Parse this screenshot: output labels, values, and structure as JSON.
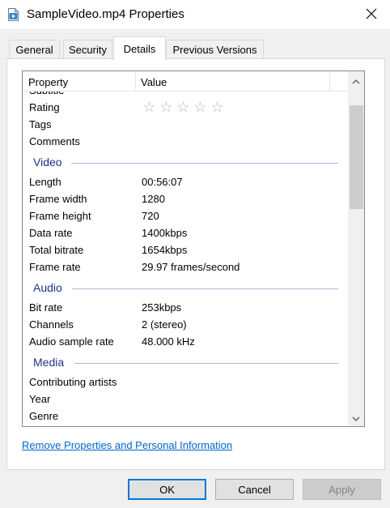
{
  "window": {
    "title": "SampleVideo.mp4 Properties",
    "icon": "video-file-icon",
    "close_icon": "close-icon"
  },
  "tabs": [
    {
      "label": "General",
      "active": false
    },
    {
      "label": "Security",
      "active": false
    },
    {
      "label": "Details",
      "active": true
    },
    {
      "label": "Previous Versions",
      "active": false
    }
  ],
  "list": {
    "headers": {
      "property": "Property",
      "value": "Value"
    },
    "cut_off_row": "Subtitle",
    "rating_label": "Rating",
    "rating_value": 0,
    "rating_max": 5,
    "rating_star": "☆",
    "description_rows": [
      {
        "property": "Tags",
        "value": ""
      },
      {
        "property": "Comments",
        "value": ""
      }
    ],
    "groups": {
      "video": {
        "label": "Video",
        "rows": [
          {
            "property": "Length",
            "value": "00:56:07"
          },
          {
            "property": "Frame width",
            "value": "1280"
          },
          {
            "property": "Frame height",
            "value": "720"
          },
          {
            "property": "Data rate",
            "value": "1400kbps"
          },
          {
            "property": "Total bitrate",
            "value": "1654kbps"
          },
          {
            "property": "Frame rate",
            "value": "29.97 frames/second"
          }
        ]
      },
      "audio": {
        "label": "Audio",
        "rows": [
          {
            "property": "Bit rate",
            "value": "253kbps"
          },
          {
            "property": "Channels",
            "value": "2 (stereo)"
          },
          {
            "property": "Audio sample rate",
            "value": "48.000 kHz"
          }
        ]
      },
      "media": {
        "label": "Media",
        "rows": [
          {
            "property": "Contributing artists",
            "value": ""
          },
          {
            "property": "Year",
            "value": ""
          },
          {
            "property": "Genre",
            "value": ""
          }
        ]
      }
    }
  },
  "link": "Remove Properties and Personal Information",
  "buttons": {
    "ok": "OK",
    "cancel": "Cancel",
    "apply": "Apply"
  },
  "colors": {
    "accent": "#0078d7",
    "group_heading": "#1e3287",
    "link": "#0066cc"
  }
}
